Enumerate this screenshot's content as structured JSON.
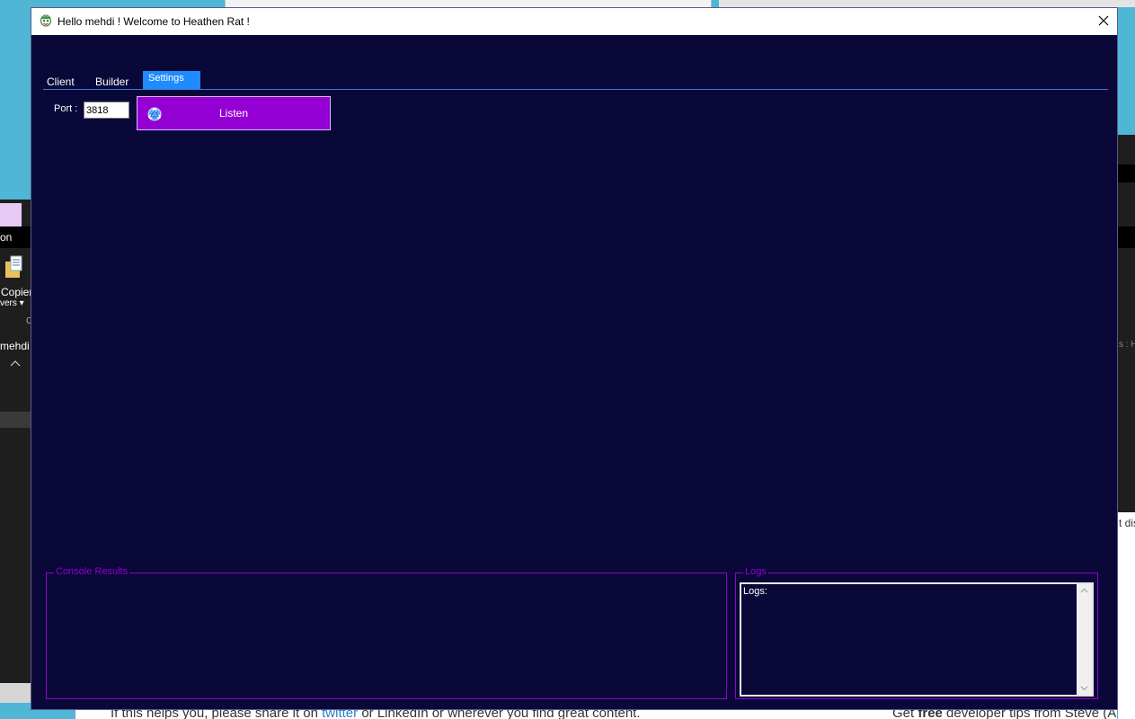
{
  "background": {
    "left_label_1": "on",
    "left_label_2": "Copier",
    "left_label_3": "vers ▾",
    "left_label_4": "C",
    "left_label_5": "mehdi",
    "right_label_1": "s : H",
    "right_label_2": "t dis",
    "web_text_before": "If this helps you, please share it on ",
    "web_link": "twitter",
    "web_text_after": " or LinkedIn or wherever you find great content.",
    "web_right_text_1": "Get ",
    "web_right_bold": "free",
    "web_right_text_2": " developer tips from Steve (Ar"
  },
  "window": {
    "title": "Hello mehdi ! Welcome to Heathen Rat !",
    "icon": "joker-app-icon",
    "close_icon": "close-icon"
  },
  "tabs": [
    {
      "label": "Client",
      "selected": false
    },
    {
      "label": "Builder",
      "selected": false
    },
    {
      "label": "Settings",
      "selected": true
    }
  ],
  "settings": {
    "port_label": "Port :",
    "port_value": "3818",
    "listen_label": "Listen",
    "listen_icon": "network-icon"
  },
  "console": {
    "legend": "Console Results"
  },
  "logs": {
    "legend": "Logs",
    "text": "Logs:"
  },
  "colors": {
    "window_bg": "#090838",
    "accent_purple": "#9400d3",
    "tab_selected": "#1f8bff"
  }
}
